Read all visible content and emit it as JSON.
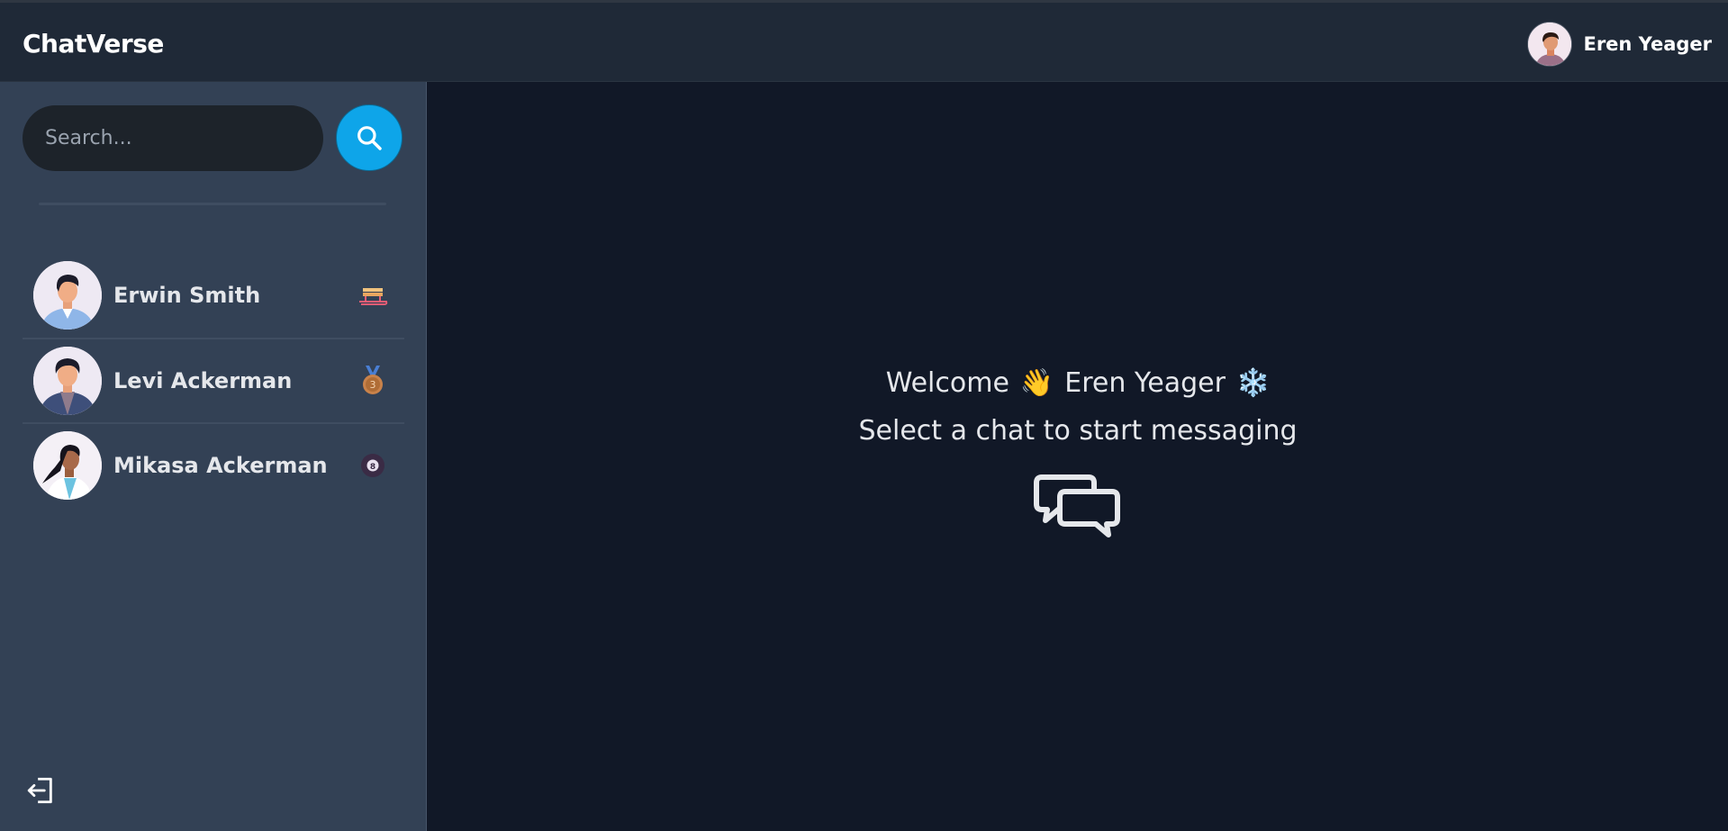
{
  "app": {
    "title": "ChatVerse"
  },
  "header": {
    "user_name": "Eren Yeager"
  },
  "sidebar": {
    "search_placeholder": "Search...",
    "contacts": [
      {
        "name": "Erwin Smith",
        "emoji": "sled"
      },
      {
        "name": "Levi Ackerman",
        "emoji": "third-place-medal"
      },
      {
        "name": "Mikasa Ackerman",
        "emoji": "pool-8-ball"
      }
    ]
  },
  "main": {
    "welcome_word": "Welcome",
    "welcome_emoji": "👋",
    "user_name": "Eren Yeager",
    "user_emoji": "❄️",
    "subtitle": "Select a chat to start messaging"
  },
  "colors": {
    "accent": "#0ea5e9",
    "sidebar_bg": "#334155",
    "main_bg": "#111827",
    "header_bg": "#1f2937"
  }
}
